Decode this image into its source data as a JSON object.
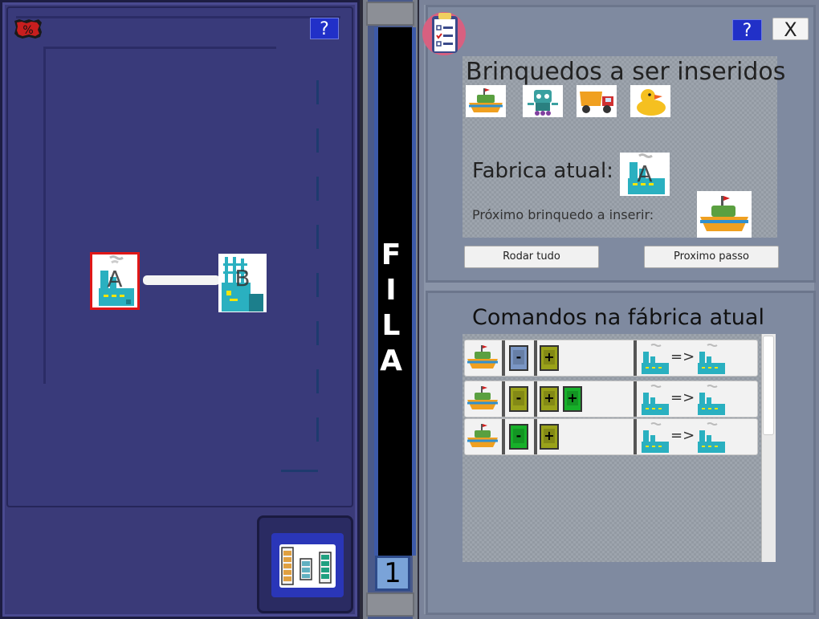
{
  "left_board": {
    "help_label": "?",
    "nodes": [
      {
        "label": "A",
        "selected": true
      },
      {
        "label": "B",
        "selected": false
      }
    ]
  },
  "queue": {
    "label_letters": [
      "F",
      "I",
      "L",
      "A"
    ],
    "count": "1"
  },
  "right_panel": {
    "help_label": "?",
    "close_label": "X",
    "toys_title": "Brinquedos a ser inseridos",
    "toys": [
      "boat-icon",
      "robot-icon",
      "truck-icon",
      "duck-icon"
    ],
    "current_factory_label": "Fabrica atual:",
    "current_factory": "A",
    "next_toy_label": "Próximo brinquedo a inserir:",
    "next_toy": "boat-icon",
    "run_all_label": "Rodar tudo",
    "next_step_label": "Proximo passo",
    "commands_title": "Comandos na fábrica atual",
    "commands": [
      {
        "toy": "boat-icon",
        "ops": [
          "-",
          "+"
        ],
        "arrow": "=>"
      },
      {
        "toy": "boat-icon",
        "ops": [
          "-",
          "+",
          "+"
        ],
        "arrow": "=>"
      },
      {
        "toy": "boat-icon",
        "ops": [
          "-",
          "+"
        ],
        "arrow": "=>"
      }
    ]
  },
  "colors": {
    "board_bg": "#3a3a78",
    "selected_border": "#e01717",
    "help_button": "#2130c8"
  }
}
